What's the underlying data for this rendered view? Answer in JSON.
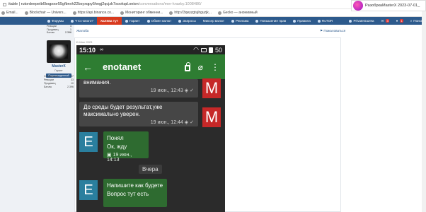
{
  "browser": {
    "url_main": "itable | rutordeepeib6loqpoor55gfbnvh22bsyxqpy5hngj2qcjzk7sookqd.onion",
    "url_path": "/conversations/mer-knarby.1008480/",
    "bookmarks": [
      {
        "label": "Email..."
      },
      {
        "label": "Blockchair — Univers..."
      },
      {
        "label": "https://api.binance.co..."
      },
      {
        "label": "Мониторинг обменни..."
      },
      {
        "label": "http://3qeyzgtujhguzjk..."
      },
      {
        "label": "Gecko — анонимный"
      }
    ],
    "notification": "PaзoбpкaMasterX 2023-07-01_"
  },
  "nav": {
    "items": [
      {
        "label": "Форумы"
      },
      {
        "label": "Что нового?"
      },
      {
        "label": "Халява тут"
      },
      {
        "label": "Гарант"
      },
      {
        "label": "Обмен валют"
      },
      {
        "label": "Запросы"
      },
      {
        "label": "Миксер валют"
      },
      {
        "label": "Реклама"
      },
      {
        "label": "Повышение прав"
      },
      {
        "label": "Правила"
      },
      {
        "label": "RuTOR"
      }
    ],
    "right": {
      "label": "PrivateGazeta",
      "badge1": "3",
      "badge2": "1",
      "search": "Поиск"
    }
  },
  "sidebar": {
    "top_stats": [
      {
        "k": "Реакции",
        "v": "4"
      },
      {
        "k": "Продавец",
        "v": "1"
      },
      {
        "k": "Баллы",
        "v": "2.396"
      }
    ],
    "user": {
      "name": "MasterX",
      "rank": "Гарант",
      "badge": "Подтвержденный"
    },
    "stats": [
      {
        "k": "Сообщения",
        "v": "97"
      },
      {
        "k": "Реакции",
        "v": "33"
      },
      {
        "k": "Продавец",
        "v": "10"
      },
      {
        "k": "Баллы",
        "v": "2.396"
      }
    ]
  },
  "content": {
    "breadcrumb": "Жалоба",
    "report": "Пожаловаться",
    "post_date": "11 Июн 2023"
  },
  "chat": {
    "status": {
      "time": "15:10",
      "infinity": "∞",
      "battery": "50"
    },
    "title": "enotanet",
    "messages": [
      {
        "text": "внимания.",
        "meta": "19 июн., 12:43"
      },
      {
        "text1": "До среды будет результат,уже",
        "text2": "максимально уверен.",
        "meta": "19 июн., 12:44"
      }
    ],
    "avatar_m": "M",
    "avatar_e": "E",
    "incoming": [
      {
        "text1": "Понял",
        "text2": "Ок, жду",
        "meta": "19 июн., 14:13"
      },
      {
        "text1": "Напишите как будете",
        "text2": "Вопрос тут есть"
      }
    ],
    "day_sep": "Вчера"
  }
}
